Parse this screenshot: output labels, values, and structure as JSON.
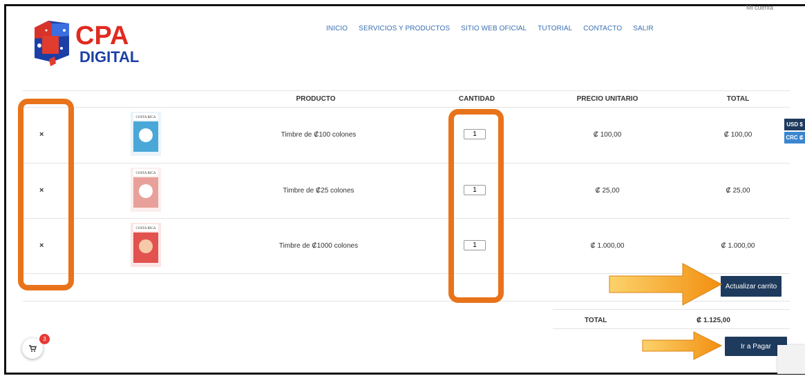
{
  "header": {
    "account_link": "Mi cuenta",
    "logo_text_top": "CPA",
    "logo_text_bottom": "DIGITAL",
    "nav": [
      "INICIO",
      "SERVICIOS Y PRODUCTOS",
      "SITIO WEB OFICIAL",
      "TUTORIAL",
      "CONTACTO",
      "SALIR"
    ]
  },
  "cart": {
    "columns": {
      "product": "PRODUCTO",
      "quantity": "CANTIDAD",
      "unit_price": "PRECIO UNITARIO",
      "total": "TOTAL"
    },
    "remove_symbol": "×",
    "items": [
      {
        "name": "Timbre de ₡100 colones",
        "quantity": "1",
        "unit_price": "₡ 100,00",
        "total": "₡ 100,00",
        "stamp_color": "#4aa8d8",
        "stamp_label": "COSTA RICA"
      },
      {
        "name": "Timbre de ₡25 colones",
        "quantity": "1",
        "unit_price": "₡ 25,00",
        "total": "₡ 25,00",
        "stamp_color": "#e8a19a",
        "stamp_label": "COSTA RICA"
      },
      {
        "name": "Timbre de ₡1000 colones",
        "quantity": "1",
        "unit_price": "₡ 1.000,00",
        "total": "₡ 1.000,00",
        "stamp_color": "#e2524e",
        "stamp_label": "COSTA RICA"
      }
    ],
    "update_button": "Actualizar carrito",
    "summary_label": "TOTAL",
    "summary_value": "₡ 1.125,00",
    "checkout_button": "Ir a Pagar"
  },
  "currency_switcher": {
    "usd": "USD $",
    "crc": "CRC ₡"
  },
  "floating_cart": {
    "count": "3",
    "icon": "cart-icon"
  },
  "colors": {
    "accent": "#1e3a5c",
    "highlight": "#e8731a",
    "arrow": "#f7a01c",
    "nav": "#3a6fb0"
  }
}
